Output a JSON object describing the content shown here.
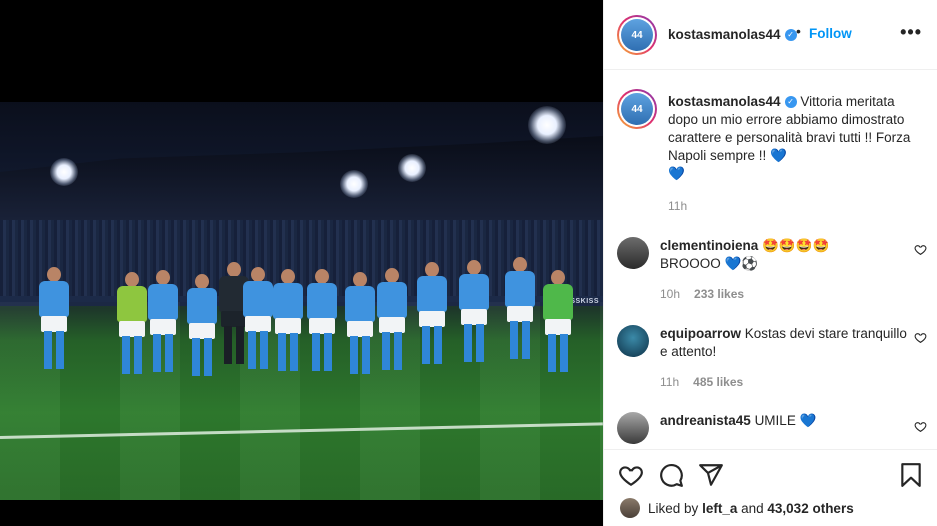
{
  "post": {
    "author": "kostasmanolas44",
    "follow_label": "Follow",
    "header_dot": "•",
    "more_label": "•••",
    "caption": "Vittoria meritata dopo un mio errore abbiamo dimostrato carattere e personalità bravi tutti !! Forza Napoli sempre !!",
    "caption_emojis": [
      "💙",
      "💙"
    ],
    "caption_time": "11h",
    "photo_board_text": "KISSKISS"
  },
  "comments": [
    {
      "username": "clementinoiena",
      "text": "🤩🤩🤩🤩",
      "text2": "BROOOO 💙⚽",
      "time": "10h",
      "likes": "233 likes"
    },
    {
      "username": "equipoarrow",
      "text": "Kostas devi stare tranquillo e attento!",
      "time": "11h",
      "likes": "485 likes"
    },
    {
      "username": "andreanista45",
      "text": "UMILE 💙"
    }
  ],
  "actions": {
    "liked_by_prefix": "Liked by",
    "liked_by_user": "left_a",
    "liked_by_mid": "and",
    "liked_by_count": "43,032 others"
  },
  "colors": {
    "accent": "#0095f6",
    "verified": "#3897f0",
    "napoli_blue": "#3f93df"
  },
  "icons": [
    "verified-icon",
    "more-icon",
    "heart-icon",
    "comment-icon",
    "share-icon",
    "bookmark-icon"
  ]
}
